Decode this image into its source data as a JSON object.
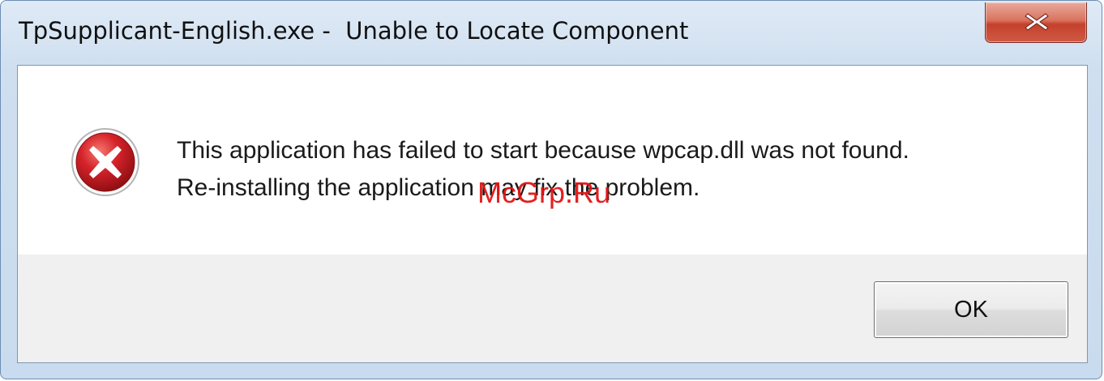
{
  "window": {
    "title": "TpSupplicant-English.exe -  Unable to Locate Component",
    "close_glyph": "close-icon"
  },
  "dialog": {
    "icon": "error-icon",
    "message_line1": "This application has failed to start because wpcap.dll was not found.",
    "message_line2": "Re-installing the application may fix the problem.",
    "ok_label": "OK"
  },
  "watermark": {
    "text": "McGrp.Ru"
  },
  "colors": {
    "close_button": "#c5412c",
    "error_icon": "#c0181c",
    "watermark": "#e11414",
    "frame": "#cfdff0"
  }
}
